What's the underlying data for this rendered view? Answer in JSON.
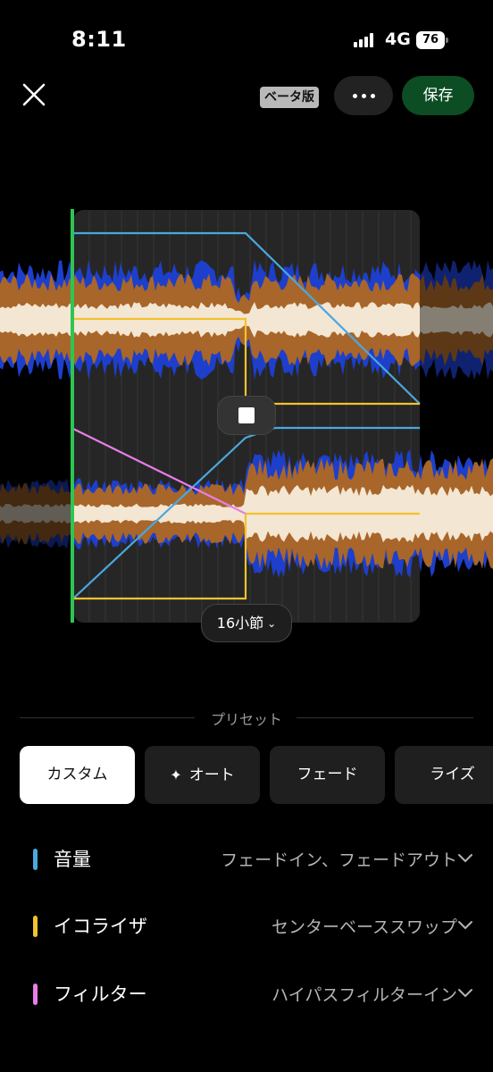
{
  "status_bar": {
    "time": "8:11",
    "network": "4G",
    "battery": "76"
  },
  "toolbar": {
    "beta_label": "ベータ版",
    "save_label": "保存",
    "accent_color": "#0d4d24"
  },
  "editor": {
    "bars_label": "16小節",
    "colors": {
      "volume": "#4aa8e0",
      "eq": "#f2c230",
      "filter": "#e77ee8",
      "playhead": "#2dc653",
      "wave_outer": "#1d3fcc",
      "wave_mid": "#a8662a",
      "wave_inner": "#f3e6d2"
    }
  },
  "presets": {
    "header": "プリセット",
    "items": [
      {
        "label": "カスタム",
        "active": true
      },
      {
        "label": "オート",
        "icon": "sparkle-icon",
        "active": false
      },
      {
        "label": "フェード",
        "active": false
      },
      {
        "label": "ライズ",
        "active": false
      }
    ]
  },
  "tracks": [
    {
      "name": "音量",
      "value": "フェードイン、フェードアウト",
      "color": "#4aa8e0"
    },
    {
      "name": "イコライザ",
      "value": "センターベーススワップ",
      "color": "#f2c230"
    },
    {
      "name": "フィルター",
      "value": "ハイパスフィルターイン",
      "color": "#e77ee8"
    }
  ]
}
